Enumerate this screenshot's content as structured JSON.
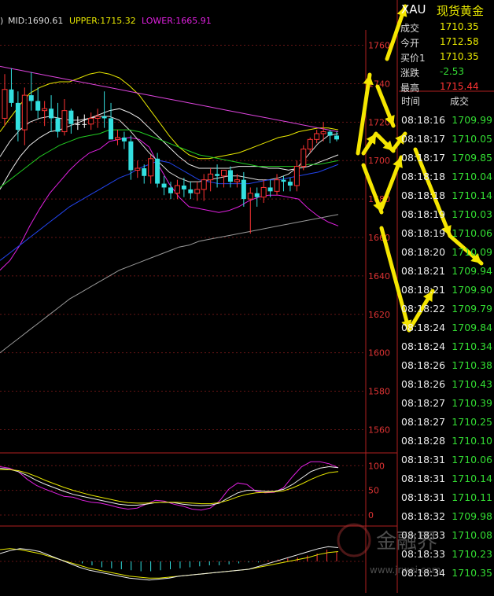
{
  "header": {
    "paren": ")",
    "mid": "MID:1690.61",
    "upper": "UPPER:1715.32",
    "lower": "LOWER:1665.91"
  },
  "quote": {
    "symbol": "XAU",
    "name": "现货黄金",
    "fields": [
      {
        "label": "成交",
        "value": "1710.35",
        "color": "#e8e800"
      },
      {
        "label": "今开",
        "value": "1712.58",
        "color": "#e8e800"
      },
      {
        "label": "买价1",
        "value": "1710.35",
        "color": "#e8e800"
      },
      {
        "label": "涨跌",
        "value": "-2.53",
        "color": "#33dd33"
      },
      {
        "label": "最高",
        "value": "1715.44",
        "color": "#ff3333"
      }
    ]
  },
  "trades": {
    "col_time": "时间",
    "col_price": "成交",
    "rows": [
      {
        "time": "08:18:16",
        "price": "1709.99"
      },
      {
        "time": "08:18:17",
        "price": "1710.05"
      },
      {
        "time": "08:18:17",
        "price": "1709.85"
      },
      {
        "time": "08:18:18",
        "price": "1710.04"
      },
      {
        "time": "08:18:18",
        "price": "1710.14"
      },
      {
        "time": "08:18:19",
        "price": "1710.03"
      },
      {
        "time": "08:18:19",
        "price": "1710.06"
      },
      {
        "time": "08:18:20",
        "price": "1710.09"
      },
      {
        "time": "08:18:21",
        "price": "1709.94"
      },
      {
        "time": "08:18:21",
        "price": "1709.90"
      },
      {
        "time": "08:18:22",
        "price": "1709.79"
      },
      {
        "time": "08:18:24",
        "price": "1709.84"
      },
      {
        "time": "08:18:24",
        "price": "1710.34"
      },
      {
        "time": "08:18:26",
        "price": "1710.38"
      },
      {
        "time": "08:18:26",
        "price": "1710.43"
      },
      {
        "time": "08:18:27",
        "price": "1710.39"
      },
      {
        "time": "08:18:27",
        "price": "1710.25"
      },
      {
        "time": "08:18:28",
        "price": "1710.10"
      },
      {
        "time": "08:18:31",
        "price": "1710.06"
      },
      {
        "time": "08:18:31",
        "price": "1710.14"
      },
      {
        "time": "08:18:31",
        "price": "1710.11"
      },
      {
        "time": "08:18:32",
        "price": "1709.98"
      },
      {
        "time": "08:18:33",
        "price": "1710.08"
      },
      {
        "time": "08:18:33",
        "price": "1710.23"
      },
      {
        "time": "08:18:34",
        "price": "1710.35"
      }
    ]
  },
  "watermark": {
    "text": "金融界",
    "url": "www.jrwei.com"
  },
  "chart_data": [
    {
      "type": "candlestick",
      "ylim": [
        1552,
        1768
      ],
      "yticks": [
        "1760",
        "1740",
        "1720",
        "1700",
        "1680",
        "1660",
        "1640",
        "1620",
        "1600",
        "1580",
        "1560"
      ],
      "colors": {
        "up": "#ff3333",
        "down": "#33e0e0",
        "mid": "#eeeeee",
        "upper": "#e8e800",
        "lower": "#e020e0"
      },
      "candles": [
        {
          "o": 1722,
          "h": 1745,
          "l": 1718,
          "c": 1737
        },
        {
          "o": 1737,
          "h": 1748,
          "l": 1728,
          "c": 1730
        },
        {
          "o": 1730,
          "h": 1736,
          "l": 1710,
          "c": 1716
        },
        {
          "o": 1716,
          "h": 1738,
          "l": 1708,
          "c": 1734
        },
        {
          "o": 1734,
          "h": 1746,
          "l": 1726,
          "c": 1731
        },
        {
          "o": 1731,
          "h": 1738,
          "l": 1722,
          "c": 1726
        },
        {
          "o": 1726,
          "h": 1731,
          "l": 1718,
          "c": 1727
        },
        {
          "o": 1727,
          "h": 1734,
          "l": 1715,
          "c": 1722
        },
        {
          "o": 1722,
          "h": 1730,
          "l": 1712,
          "c": 1715
        },
        {
          "o": 1715,
          "h": 1732,
          "l": 1713,
          "c": 1726
        },
        {
          "o": 1726,
          "h": 1727,
          "l": 1714,
          "c": 1719
        },
        {
          "o": 1719,
          "h": 1723,
          "l": 1716,
          "c": 1719
        },
        {
          "o": 1719,
          "h": 1724,
          "l": 1717,
          "c": 1719
        },
        {
          "o": 1719,
          "h": 1725,
          "l": 1716,
          "c": 1722
        },
        {
          "o": 1722,
          "h": 1727,
          "l": 1717,
          "c": 1723
        },
        {
          "o": 1723,
          "h": 1736,
          "l": 1717,
          "c": 1722
        },
        {
          "o": 1722,
          "h": 1730,
          "l": 1715,
          "c": 1711
        },
        {
          "o": 1711,
          "h": 1716,
          "l": 1708,
          "c": 1712
        },
        {
          "o": 1712,
          "h": 1715,
          "l": 1706,
          "c": 1710
        },
        {
          "o": 1710,
          "h": 1713,
          "l": 1690,
          "c": 1695
        },
        {
          "o": 1695,
          "h": 1700,
          "l": 1691,
          "c": 1696
        },
        {
          "o": 1696,
          "h": 1698,
          "l": 1688,
          "c": 1692
        },
        {
          "o": 1692,
          "h": 1703,
          "l": 1688,
          "c": 1701
        },
        {
          "o": 1701,
          "h": 1704,
          "l": 1686,
          "c": 1688
        },
        {
          "o": 1688,
          "h": 1692,
          "l": 1682,
          "c": 1686
        },
        {
          "o": 1686,
          "h": 1689,
          "l": 1680,
          "c": 1683
        },
        {
          "o": 1683,
          "h": 1690,
          "l": 1680,
          "c": 1687
        },
        {
          "o": 1687,
          "h": 1691,
          "l": 1681,
          "c": 1685
        },
        {
          "o": 1685,
          "h": 1689,
          "l": 1680,
          "c": 1683
        },
        {
          "o": 1683,
          "h": 1689,
          "l": 1679,
          "c": 1685
        },
        {
          "o": 1685,
          "h": 1693,
          "l": 1679,
          "c": 1690
        },
        {
          "o": 1690,
          "h": 1696,
          "l": 1684,
          "c": 1693
        },
        {
          "o": 1693,
          "h": 1698,
          "l": 1686,
          "c": 1692
        },
        {
          "o": 1692,
          "h": 1695,
          "l": 1686,
          "c": 1695
        },
        {
          "o": 1695,
          "h": 1697,
          "l": 1686,
          "c": 1689
        },
        {
          "o": 1689,
          "h": 1693,
          "l": 1686,
          "c": 1690
        },
        {
          "o": 1690,
          "h": 1694,
          "l": 1676,
          "c": 1680
        },
        {
          "o": 1680,
          "h": 1686,
          "l": 1662,
          "c": 1683
        },
        {
          "o": 1683,
          "h": 1686,
          "l": 1676,
          "c": 1681
        },
        {
          "o": 1681,
          "h": 1690,
          "l": 1678,
          "c": 1686
        },
        {
          "o": 1686,
          "h": 1690,
          "l": 1681,
          "c": 1684
        },
        {
          "o": 1684,
          "h": 1693,
          "l": 1682,
          "c": 1690
        },
        {
          "o": 1690,
          "h": 1692,
          "l": 1684,
          "c": 1689
        },
        {
          "o": 1689,
          "h": 1691,
          "l": 1684,
          "c": 1687
        },
        {
          "o": 1687,
          "h": 1700,
          "l": 1684,
          "c": 1697
        },
        {
          "o": 1697,
          "h": 1708,
          "l": 1695,
          "c": 1706
        },
        {
          "o": 1706,
          "h": 1712,
          "l": 1704,
          "c": 1711
        },
        {
          "o": 1711,
          "h": 1716,
          "l": 1709,
          "c": 1714
        },
        {
          "o": 1714,
          "h": 1720,
          "l": 1710,
          "c": 1715
        },
        {
          "o": 1715,
          "h": 1716,
          "l": 1709,
          "c": 1713
        },
        {
          "o": 1713,
          "h": 1715,
          "l": 1710,
          "c": 1711
        }
      ],
      "lines": [
        {
          "color": "#e8e800",
          "values": [
            1715,
            1722,
            1729,
            1735,
            1738,
            1740,
            1741,
            1741,
            1743,
            1745,
            1746,
            1745,
            1743,
            1739,
            1734,
            1727,
            1720,
            1713,
            1707,
            1703,
            1701,
            1701,
            1702,
            1703,
            1704,
            1706,
            1708,
            1710,
            1712,
            1713,
            1715,
            1716,
            1717,
            1717,
            1716
          ]
        },
        {
          "color": "#e020e0",
          "values": [
            1643,
            1648,
            1656,
            1666,
            1675,
            1683,
            1689,
            1695,
            1700,
            1704,
            1706,
            1710,
            1711,
            1712,
            1711,
            1707,
            1697,
            1688,
            1681,
            1676,
            1675,
            1674,
            1673,
            1674,
            1676,
            1679,
            1681,
            1682,
            1682,
            1681,
            1680,
            1675,
            1671,
            1668,
            1666
          ]
        },
        {
          "color": "#eeeeee",
          "values": [
            1685,
            1694,
            1702,
            1708,
            1712,
            1715,
            1716,
            1718,
            1720,
            1722,
            1724,
            1726,
            1727,
            1725,
            1722,
            1717,
            1712,
            1707,
            1702,
            1698,
            1696,
            1696,
            1696,
            1696,
            1697,
            1697,
            1697,
            1696,
            1696,
            1695,
            1696,
            1697,
            1699,
            1701,
            1703
          ]
        },
        {
          "color": "#dddddd",
          "values": [
            1702,
            1710,
            1716,
            1720,
            1722,
            1723,
            1722,
            1721,
            1721,
            1722,
            1723,
            1723,
            1721,
            1716,
            1710,
            1704,
            1699,
            1694,
            1691,
            1689,
            1689,
            1690,
            1691,
            1692,
            1692,
            1691,
            1690,
            1690,
            1691,
            1693,
            1697,
            1703,
            1709,
            1713,
            1714
          ]
        },
        {
          "color": "#22cc22",
          "values": [
            1686,
            1690,
            1694,
            1698,
            1702,
            1705,
            1708,
            1710,
            1712,
            1713,
            1714,
            1716,
            1716,
            1716,
            1715,
            1713,
            1711,
            1709,
            1707,
            1705,
            1703,
            1702,
            1701,
            1700,
            1699,
            1698,
            1697,
            1697,
            1697,
            1697,
            1697,
            1698,
            1698,
            1699,
            1700
          ]
        },
        {
          "color": "#2244ee",
          "values": [
            1648,
            1652,
            1656,
            1660,
            1664,
            1668,
            1672,
            1676,
            1679,
            1682,
            1685,
            1688,
            1691,
            1693,
            1696,
            1698,
            1700,
            1699,
            1696,
            1693,
            1690,
            1689,
            1688,
            1688,
            1688,
            1688,
            1689,
            1690,
            1690,
            1691,
            1692,
            1693,
            1694,
            1696,
            1698
          ]
        },
        {
          "color": "#999999",
          "values": [
            1600,
            1604,
            1608,
            1612,
            1616,
            1620,
            1624,
            1628,
            1631,
            1634,
            1637,
            1640,
            1643,
            1645,
            1647,
            1649,
            1651,
            1653,
            1655,
            1656,
            1658,
            1659,
            1660,
            1661,
            1662,
            1663,
            1664,
            1665,
            1666,
            1667,
            1668,
            1669,
            1670,
            1671,
            1672
          ]
        },
        {
          "color": "#dd44dd",
          "values": [
            1749,
            1748,
            1747,
            1746,
            1745,
            1744,
            1743,
            1742,
            1741,
            1740,
            1739,
            1738,
            1737,
            1736,
            1735,
            1734,
            1733,
            1732,
            1731,
            1730,
            1729,
            1728,
            1727,
            1726,
            1725,
            1724,
            1723,
            1722,
            1721,
            1720,
            1719,
            1718,
            1717,
            1716,
            1715
          ]
        }
      ]
    },
    {
      "type": "line",
      "ylim": [
        0,
        110
      ],
      "yticks": [
        "100",
        "50",
        "0"
      ],
      "series": [
        {
          "color": "#e020e0",
          "values": [
            98,
            95,
            88,
            72,
            60,
            52,
            45,
            38,
            36,
            30,
            26,
            24,
            20,
            15,
            12,
            14,
            22,
            30,
            28,
            22,
            18,
            12,
            10,
            14,
            28,
            52,
            65,
            62,
            48,
            45,
            46,
            55,
            78,
            98,
            108,
            108,
            104,
            96
          ]
        },
        {
          "color": "#eeeeee",
          "values": [
            95,
            93,
            88,
            80,
            70,
            62,
            55,
            48,
            42,
            38,
            34,
            30,
            26,
            22,
            20,
            20,
            22,
            25,
            26,
            25,
            22,
            20,
            19,
            20,
            24,
            35,
            45,
            50,
            50,
            48,
            48,
            52,
            62,
            75,
            88,
            95,
            98,
            96
          ]
        },
        {
          "color": "#e8e800",
          "values": [
            92,
            92,
            90,
            85,
            78,
            70,
            63,
            56,
            50,
            45,
            40,
            36,
            32,
            28,
            25,
            24,
            24,
            25,
            26,
            26,
            25,
            24,
            23,
            23,
            25,
            30,
            37,
            42,
            45,
            46,
            47,
            49,
            55,
            63,
            72,
            80,
            86,
            88
          ]
        }
      ]
    },
    {
      "type": "line",
      "ylim": [
        -16,
        16
      ],
      "series": [
        {
          "color": "#e8e800",
          "values": [
            6,
            6.5,
            6,
            5,
            4,
            2.5,
            1,
            -0.5,
            -2,
            -3.5,
            -4.5,
            -5.5,
            -6.5,
            -7.5,
            -8,
            -8.5,
            -8.5,
            -8,
            -7.5,
            -7,
            -6.5,
            -6,
            -5.5,
            -5,
            -4.5,
            -4,
            -3,
            -2,
            -1,
            0,
            1,
            2,
            3.5,
            4.5,
            5
          ]
        },
        {
          "color": "#eeeeee",
          "values": [
            4,
            5.5,
            6.5,
            6,
            5,
            3,
            1,
            -1,
            -3,
            -4.5,
            -5.5,
            -6.5,
            -7.5,
            -8.5,
            -9,
            -9.5,
            -9,
            -8.5,
            -7.5,
            -7,
            -6.5,
            -6,
            -5.5,
            -5,
            -4.5,
            -4,
            -2.5,
            -1,
            0.5,
            2,
            3.5,
            5,
            6.5,
            7.5,
            7
          ]
        }
      ],
      "bars": [
        0,
        0,
        0,
        0,
        0,
        0,
        0,
        0,
        -1,
        -2,
        -3,
        -3.5,
        -4,
        -4.5,
        -5,
        -5,
        -4.5,
        -4,
        -3.5,
        -3,
        -2.5,
        -2,
        -2,
        -1.5,
        -1,
        -0.5,
        -0.5,
        0.5,
        1,
        1.5,
        2,
        3,
        4,
        6,
        5
      ]
    }
  ]
}
